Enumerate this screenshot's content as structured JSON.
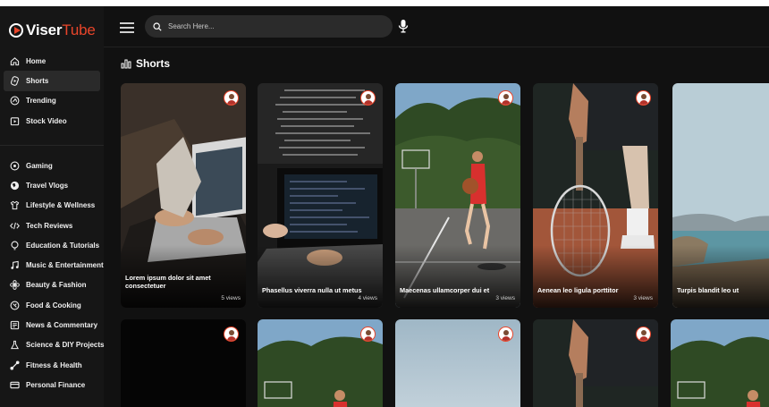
{
  "app": {
    "logo_prefix": "Viser",
    "logo_suffix": "Tube"
  },
  "search": {
    "placeholder": "Search Here..."
  },
  "sidebar": {
    "primary": [
      {
        "label": "Home",
        "icon": "home-icon"
      },
      {
        "label": "Shorts",
        "icon": "shorts-icon",
        "active": true
      },
      {
        "label": "Trending",
        "icon": "trending-icon"
      },
      {
        "label": "Stock Video",
        "icon": "stock-video-icon"
      }
    ],
    "categories": [
      {
        "label": "Gaming",
        "icon": "gaming-icon"
      },
      {
        "label": "Travel Vlogs",
        "icon": "travel-icon"
      },
      {
        "label": "Lifestyle & Wellness",
        "icon": "lifestyle-icon"
      },
      {
        "label": "Tech Reviews",
        "icon": "code-icon"
      },
      {
        "label": "Education & Tutorials",
        "icon": "education-icon"
      },
      {
        "label": "Music & Entertainment",
        "icon": "music-icon"
      },
      {
        "label": "Beauty & Fashion",
        "icon": "beauty-icon"
      },
      {
        "label": "Food & Cooking",
        "icon": "food-icon"
      },
      {
        "label": "News & Commentary",
        "icon": "news-icon"
      },
      {
        "label": "Science & DIY Projects",
        "icon": "science-icon"
      },
      {
        "label": "Fitness & Health",
        "icon": "fitness-icon"
      },
      {
        "label": "Personal Finance",
        "icon": "finance-icon"
      }
    ]
  },
  "main": {
    "section_title": "Shorts",
    "cards_row1": [
      {
        "title": "Lorem ipsum dolor sit amet consectetuer",
        "views": "5 views",
        "scene": "laptop-hands"
      },
      {
        "title": "Phasellus viverra nulla ut metus",
        "views": "4 views",
        "scene": "laptop-code"
      },
      {
        "title": "Maecenas ullamcorper dui et",
        "views": "3 views",
        "scene": "basketball-girl"
      },
      {
        "title": "Aenean leo ligula porttitor",
        "views": "3 views",
        "scene": "tennis-player"
      },
      {
        "title": "Turpis blandit leo ut",
        "views": "",
        "scene": "lake-landscape"
      }
    ],
    "cards_row2": [
      {
        "scene": "black"
      },
      {
        "scene": "basketball-girl"
      },
      {
        "scene": "sky"
      },
      {
        "scene": "tennis-player"
      },
      {
        "scene": "basketball-girl"
      }
    ]
  }
}
